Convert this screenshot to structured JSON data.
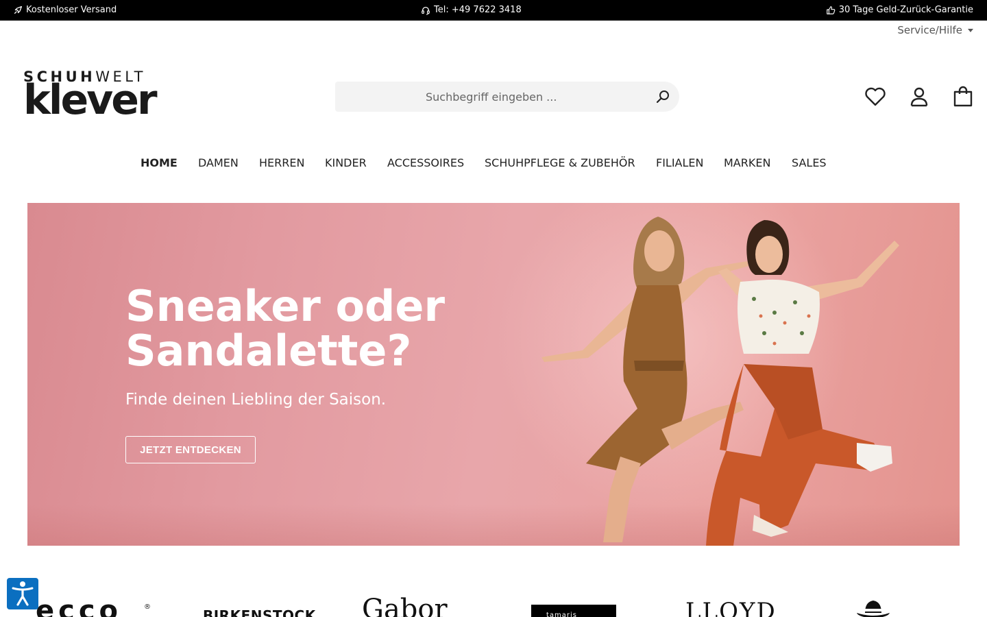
{
  "topbar": {
    "shipping": "Kostenloser Versand",
    "phone": "Tel: +49 7622 3418",
    "guarantee": "30 Tage Geld-Zurück-Garantie",
    "icons": [
      "rocket-icon",
      "headset-icon",
      "thumbs-up-icon"
    ]
  },
  "service_menu": {
    "label": "Service/Hilfe"
  },
  "logo": {
    "line1_bold": "SCHUH",
    "line1_light": "WELT",
    "line2": "klever"
  },
  "search": {
    "placeholder": "Suchbegriff eingeben ...",
    "value": ""
  },
  "header_icons": [
    "heart-icon",
    "user-icon",
    "shopping-bag-icon"
  ],
  "nav": {
    "items": [
      {
        "label": "HOME",
        "active": true
      },
      {
        "label": "DAMEN",
        "active": false
      },
      {
        "label": "HERREN",
        "active": false
      },
      {
        "label": "KINDER",
        "active": false
      },
      {
        "label": "ACCESSOIRES",
        "active": false
      },
      {
        "label": "SCHUHPFLEGE & ZUBEHÖR",
        "active": false
      },
      {
        "label": "FILIALEN",
        "active": false
      },
      {
        "label": "MARKEN",
        "active": false
      },
      {
        "label": "SALES",
        "active": false
      }
    ]
  },
  "hero": {
    "headline_line1": "Sneaker oder",
    "headline_line2": "Sandalette?",
    "subline": "Finde deinen Liebling der Saison.",
    "cta": "JETZT ENTDECKEN",
    "background_color": "#e3a0a4"
  },
  "brands": {
    "ecco": "ecco",
    "ecco_mark": "®",
    "birkenstock": "BIRKENSTOCK",
    "gabor": "Gabor",
    "tamaris": "tamaris",
    "lloyd": "LLOYD"
  },
  "colors": {
    "topbar": "#000000",
    "accessibility": "#0b6fc0",
    "search_bg": "#f3f3f3"
  }
}
